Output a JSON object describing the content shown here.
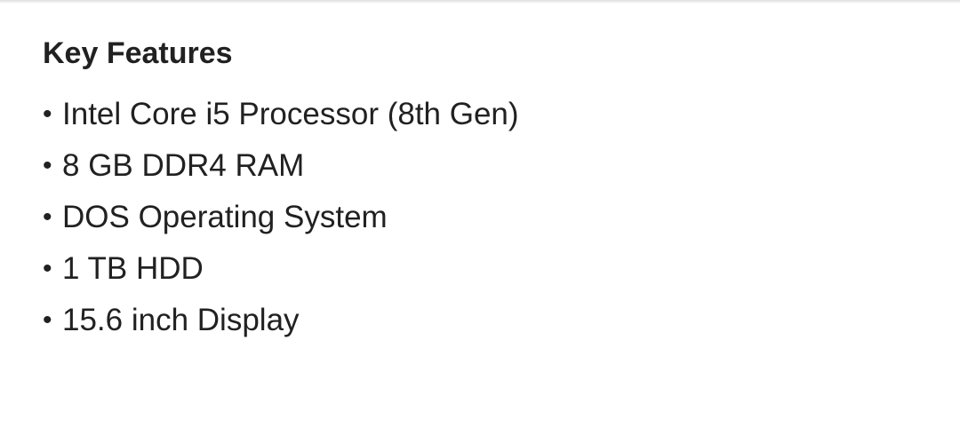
{
  "section": {
    "title": "Key Features",
    "items": [
      "Intel Core i5 Processor (8th Gen)",
      "8 GB DDR4 RAM",
      "DOS Operating System",
      "1 TB HDD",
      "15.6 inch Display"
    ]
  },
  "bullet_glyph": "•"
}
